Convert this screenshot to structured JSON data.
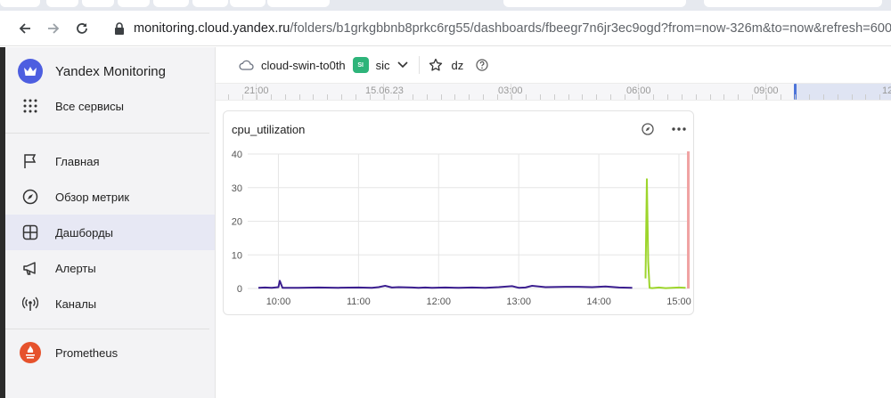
{
  "browser": {
    "url_host": "monitoring.cloud.yandex.ru",
    "url_path": "/folders/b1grkgbbnb8prkc6rg55/dashboards/fbeegr7n6jr3ec9ogd?from=now-326m&to=now&refresh=600"
  },
  "sidebar": {
    "brand": "Yandex Monitoring",
    "all_services": "Все сервисы",
    "items": [
      {
        "label": "Главная",
        "icon": "flag-icon"
      },
      {
        "label": "Обзор метрик",
        "icon": "compass-icon"
      },
      {
        "label": "Дашборды",
        "icon": "dashboard-grid-icon",
        "active": true
      },
      {
        "label": "Алерты",
        "icon": "megaphone-icon"
      },
      {
        "label": "Каналы",
        "icon": "broadcast-icon"
      }
    ],
    "prometheus": "Prometheus"
  },
  "header": {
    "cloud": "cloud-swin-to0th",
    "folder_badge": "SI",
    "folder": "sic",
    "dashboard": "dz"
  },
  "timeline": {
    "labels": [
      "21:00",
      "15.06.23",
      "03:00",
      "06:00",
      "09:00",
      "12"
    ]
  },
  "widget": {
    "title": "cpu_utilization"
  },
  "chart_data": {
    "type": "line",
    "title": "cpu_utilization",
    "xlabel": "",
    "ylabel": "",
    "ylim": [
      0,
      40
    ],
    "yticks": [
      0,
      10,
      20,
      30,
      40
    ],
    "xticks": [
      "10:00",
      "11:00",
      "12:00",
      "13:00",
      "14:00",
      "15:00"
    ],
    "grid": true,
    "legend": "none",
    "series": [
      {
        "color": "#3b1e8f",
        "x": [
          "09:45",
          "09:50",
          "09:55",
          "10:00",
          "10:01",
          "10:03",
          "10:08",
          "10:15",
          "10:30",
          "10:45",
          "11:00",
          "11:10",
          "11:15",
          "11:20",
          "11:25",
          "11:30",
          "11:40",
          "11:45",
          "11:50",
          "11:55",
          "12:05",
          "12:15",
          "12:25",
          "12:35",
          "12:45",
          "12:55",
          "13:00",
          "13:05",
          "13:10",
          "13:20",
          "13:35",
          "13:45",
          "13:55",
          "14:05",
          "14:15",
          "14:25"
        ],
        "y": [
          0.2,
          0.3,
          0.2,
          0.4,
          2.3,
          0.2,
          0.2,
          0.2,
          0.3,
          0.2,
          0.3,
          0.2,
          0.4,
          0.8,
          0.3,
          0.4,
          0.3,
          0.2,
          0.3,
          0.2,
          0.3,
          0.2,
          0.3,
          0.2,
          0.4,
          0.7,
          0.2,
          0.3,
          0.8,
          0.4,
          0.5,
          0.5,
          0.4,
          0.6,
          0.3,
          0.2
        ]
      },
      {
        "color": "#9dd52c",
        "x": [
          "14:35",
          "14:36",
          "14:37",
          "14:38",
          "14:40",
          "14:45",
          "14:50",
          "14:55",
          "15:00",
          "15:05"
        ],
        "y": [
          3,
          32.5,
          8,
          0.2,
          0.1,
          0.3,
          0.1,
          0.2,
          0.3,
          0.2
        ]
      }
    ],
    "markers": [
      {
        "x": "15:07",
        "color": "#f0a3a3"
      }
    ]
  }
}
